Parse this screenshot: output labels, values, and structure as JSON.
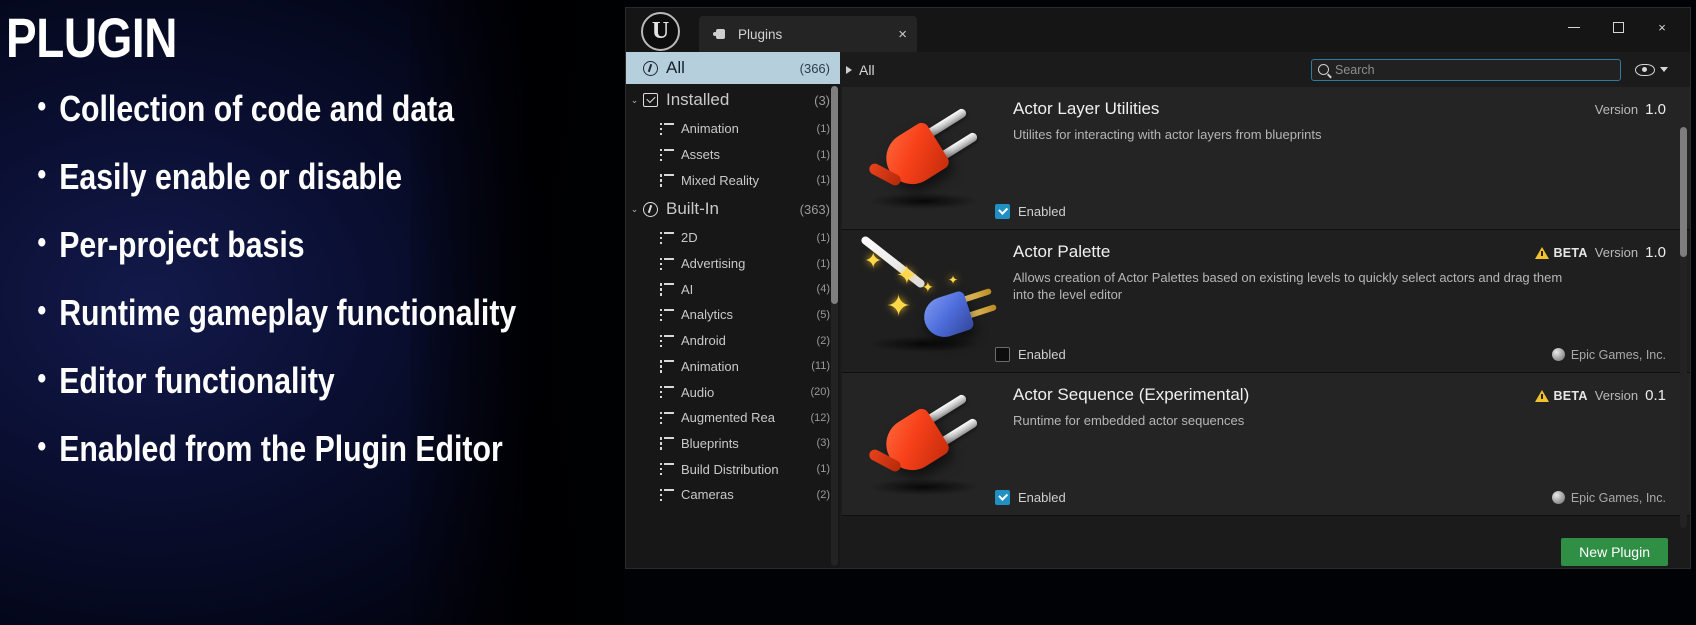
{
  "slide": {
    "title": "PLUGIN",
    "bullets": [
      "Collection of code and data",
      "Easily enable or disable",
      "Per-project basis",
      "Runtime gameplay functionality",
      "Editor functionality",
      "Enabled from the Plugin Editor"
    ]
  },
  "window": {
    "logo_glyph": "U",
    "tab_label": "Plugins",
    "tab_close": "×",
    "controls": {
      "minimize": "minimize-icon",
      "maximize": "maximize-icon",
      "close": "×"
    }
  },
  "sidebar": {
    "top_items": [
      {
        "label": "All",
        "count": "(366)",
        "icon": "unreal-circle-icon",
        "selected": true,
        "arrow": ""
      },
      {
        "label": "Installed",
        "count": "(3)",
        "icon": "installed-icon",
        "selected": false,
        "arrow": "⌄"
      },
      {
        "label": "Built-In",
        "count": "(363)",
        "icon": "unreal-circle-icon",
        "selected": false,
        "arrow": "⌄"
      }
    ],
    "installed_children": [
      {
        "label": "Animation",
        "count": "(1)"
      },
      {
        "label": "Assets",
        "count": "(1)"
      },
      {
        "label": "Mixed Reality",
        "count": "(1)"
      }
    ],
    "builtin_children": [
      {
        "label": "2D",
        "count": "(1)"
      },
      {
        "label": "Advertising",
        "count": "(1)"
      },
      {
        "label": "AI",
        "count": "(4)"
      },
      {
        "label": "Analytics",
        "count": "(5)"
      },
      {
        "label": "Android",
        "count": "(2)"
      },
      {
        "label": "Animation",
        "count": "(11)"
      },
      {
        "label": "Audio",
        "count": "(20)"
      },
      {
        "label": "Augmented Rea",
        "count": "(12)"
      },
      {
        "label": "Blueprints",
        "count": "(3)"
      },
      {
        "label": "Build Distribution",
        "count": "(1)"
      },
      {
        "label": "Cameras",
        "count": "(2)"
      }
    ]
  },
  "main": {
    "breadcrumb": "All",
    "search": {
      "value": "",
      "placeholder": "Search"
    },
    "plugins": [
      {
        "name": "Actor Layer Utilities",
        "description": "Utilites for interacting with actor layers from blueprints",
        "beta": "",
        "version_label": "Version",
        "version": "1.0",
        "enabled_label": "Enabled",
        "enabled": true,
        "vendor": "",
        "art": "plug-orange"
      },
      {
        "name": "Actor Palette",
        "description": "Allows creation of Actor Palettes based on existing levels to quickly select actors and drag them into the level editor",
        "beta": "BETA",
        "version_label": "Version",
        "version": "1.0",
        "enabled_label": "Enabled",
        "enabled": false,
        "vendor": "Epic Games, Inc.",
        "art": "plug-blue-wand"
      },
      {
        "name": "Actor Sequence (Experimental)",
        "description": "Runtime for embedded actor sequences",
        "beta": "BETA",
        "version_label": "Version",
        "version": "0.1",
        "enabled_label": "Enabled",
        "enabled": true,
        "vendor": "Epic Games, Inc.",
        "art": "plug-orange"
      }
    ],
    "new_plugin_button": "New Plugin"
  },
  "colors": {
    "accent_green": "#2f8f44",
    "accent_blue": "#1f8fc4",
    "selection": "#b6cfdd",
    "beta_yellow": "#f2c12e",
    "slide_bg": "#0b1035"
  }
}
